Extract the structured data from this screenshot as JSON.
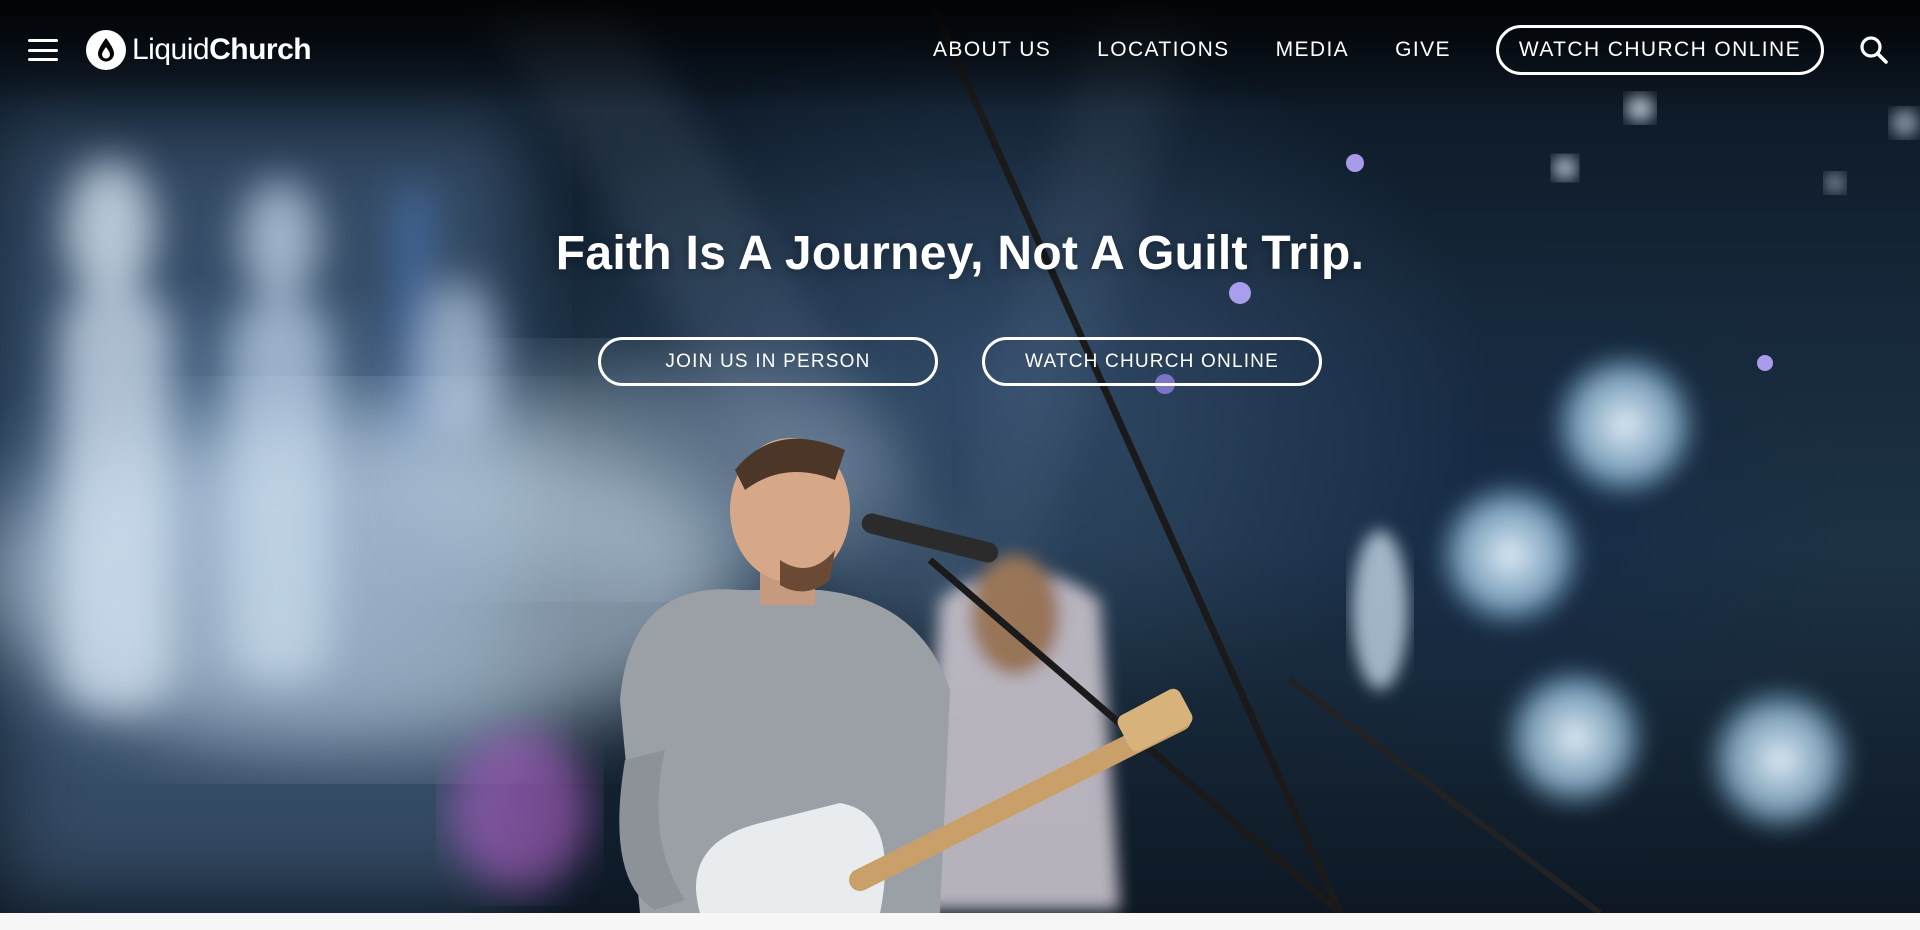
{
  "header": {
    "logo_light": "Liquid",
    "logo_bold": "Church",
    "nav": [
      "ABOUT US",
      "LOCATIONS",
      "MEDIA",
      "GIVE"
    ],
    "cta_label": "WATCH CHURCH ONLINE"
  },
  "hero": {
    "headline": "Faith Is A Journey, Not A Guilt Trip.",
    "buttons": [
      "JOIN US IN PERSON",
      "WATCH CHURCH ONLINE"
    ]
  },
  "icons": {
    "menu": "hamburger-menu-icon",
    "logo": "water-drop-icon",
    "search": "search-icon"
  },
  "colors": {
    "accent": "#ffffff",
    "hero_dark": "#0a1420"
  }
}
